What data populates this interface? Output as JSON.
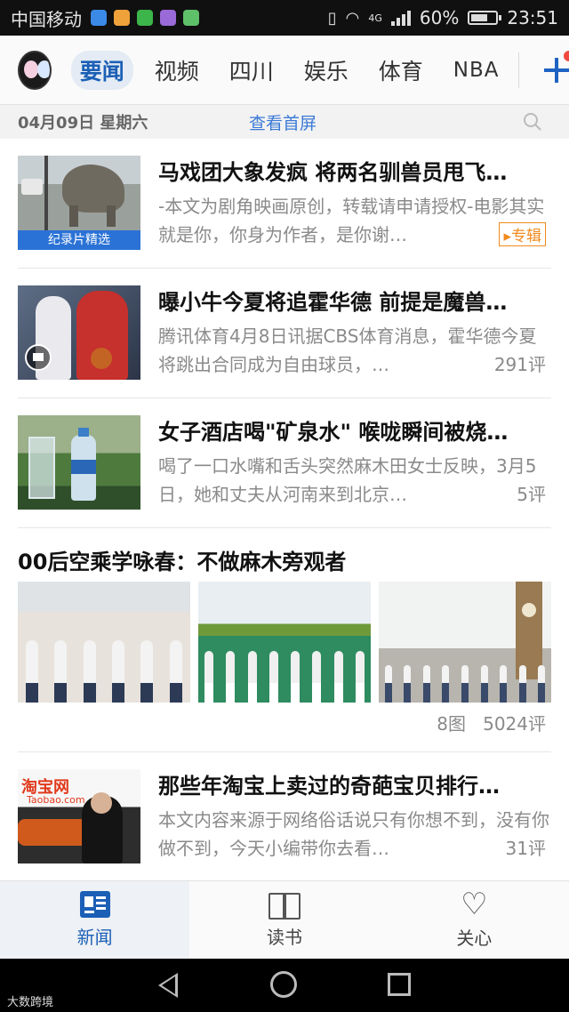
{
  "status_bar": {
    "carrier": "中国移动",
    "network": "4G",
    "battery": "60%",
    "time": "23:51"
  },
  "top_nav": {
    "tabs": [
      {
        "label": "要闻",
        "active": true
      },
      {
        "label": "视频"
      },
      {
        "label": "四川"
      },
      {
        "label": "娱乐"
      },
      {
        "label": "体育"
      },
      {
        "label": "NBA"
      }
    ],
    "add_icon": "plus-icon"
  },
  "date_bar": {
    "date": "04月09日 星期六",
    "home_link": "查看首屏",
    "search_icon": "search-icon"
  },
  "feed": {
    "items": [
      {
        "title": "马戏团大象发疯 将两名驯兽员甩飞…",
        "summary": "-本文为剧角映画原创，转载请申请授权-电影其实就是你，你身为作者，是你谢…",
        "thumb_label": "纪录片精选",
        "badge": "专辑"
      },
      {
        "title": "曝小牛今夏将追霍华德 前提是魔兽…",
        "summary": "腾讯体育4月8日讯据CBS体育消息，霍华德今夏将跳出合同成为自由球员，…",
        "comments": "291评"
      },
      {
        "title": "女子酒店喝\"矿泉水\" 喉咙瞬间被烧…",
        "summary": "喝了一口水嘴和舌头突然麻木田女士反映，3月5日，她和丈夫从河南来到北京…",
        "comments": "5评"
      },
      {
        "title": "00后空乘学咏春：不做麻木旁观者",
        "image_count": "8图",
        "comments": "5024评"
      },
      {
        "title": "那些年淘宝上卖过的奇葩宝贝排行…",
        "summary": "本文内容来源于网络俗话说只有你想不到，没有你做不到，今天小编带你去看…",
        "comments": "31评",
        "thumb_logo": "淘宝网",
        "thumb_logo_sub": "Taobao.com"
      }
    ]
  },
  "bottom_nav": {
    "items": [
      {
        "label": "新闻",
        "icon": "news-icon",
        "active": true
      },
      {
        "label": "读书",
        "icon": "book-icon"
      },
      {
        "label": "关心",
        "icon": "heart-icon"
      }
    ]
  },
  "watermark": "大数跨境",
  "colors": {
    "accent": "#1c5fb6",
    "link": "#3b7ad6",
    "badge": "#f08a1e",
    "notification_dot": "#f04a3e"
  }
}
